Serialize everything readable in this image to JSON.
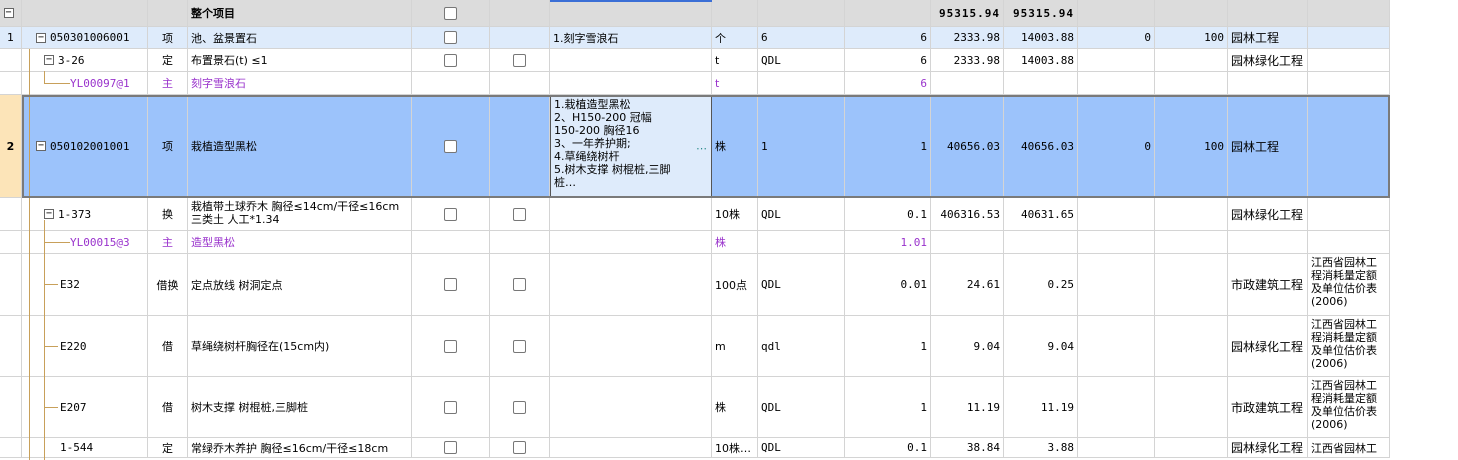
{
  "colors": {
    "summary_bg": "#dcdcdc",
    "row_hl": "#deebfb",
    "row_sel": "#9cc3fb",
    "sel_rowhdr": "#fce4b8",
    "purple": "#9932cc"
  },
  "summary": {
    "toggle": "−",
    "name": "整个项目",
    "total1": "95315.94",
    "total2": "95315.94"
  },
  "rows": [
    {
      "rn": "1",
      "code": "050301006001",
      "type": "项",
      "name": "池、盆景置石",
      "feature": "1.刻字雪浪石",
      "unit": "个",
      "expr": "6",
      "qty": "6",
      "price": "2333.98",
      "total": "14003.88",
      "c11": "0",
      "c12": "100",
      "cat": "园林工程",
      "src": ""
    },
    {
      "rn": "",
      "code": "3-26",
      "type": "定",
      "name": "布置景石(t) ≤1",
      "feature": "",
      "unit": "t",
      "expr": "QDL",
      "qty": "6",
      "price": "2333.98",
      "total": "14003.88",
      "c11": "",
      "c12": "",
      "cat": "园林绿化工程",
      "src": ""
    },
    {
      "rn": "",
      "code": "YL00097@1",
      "type": "主",
      "name": "刻字雪浪石",
      "feature": "",
      "unit": "t",
      "expr": "",
      "qty": "6",
      "price": "",
      "total": "",
      "c11": "",
      "c12": "",
      "cat": "",
      "src": ""
    },
    {
      "rn": "2",
      "code": "050102001001",
      "type": "项",
      "name": "栽植造型黑松",
      "feature": "1.栽植造型黑松\n2、H150-200 冠幅\n150-200  胸径16\n3、一年养护期;\n4.草绳绕树杆\n5.树木支撑 树棍桩,三脚\n桩…",
      "unit": "株",
      "expr": "1",
      "qty": "1",
      "price": "40656.03",
      "total": "40656.03",
      "c11": "0",
      "c12": "100",
      "cat": "园林工程",
      "src": ""
    },
    {
      "rn": "",
      "code": "1-373",
      "type": "换",
      "name": "栽植带土球乔木 胸径≤14cm/干径≤16cm\n  三类土 人工*1.34",
      "feature": "",
      "unit": "10株",
      "expr": "QDL",
      "qty": "0.1",
      "price": "406316.53",
      "total": "40631.65",
      "c11": "",
      "c12": "",
      "cat": "园林绿化工程",
      "src": ""
    },
    {
      "rn": "",
      "code": "YL00015@3",
      "type": "主",
      "name": "造型黑松",
      "feature": "",
      "unit": "株",
      "expr": "",
      "qty": "1.01",
      "price": "",
      "total": "",
      "c11": "",
      "c12": "",
      "cat": "",
      "src": ""
    },
    {
      "rn": "",
      "code": "E32",
      "type": "借换",
      "name": "定点放线 树洞定点",
      "feature": "",
      "unit": "100点",
      "expr": "QDL",
      "qty": "0.01",
      "price": "24.61",
      "total": "0.25",
      "c11": "",
      "c12": "",
      "cat": "市政建筑工程",
      "src": "江西省园林工\n程消耗量定额\n及单位估价表\n(2006)"
    },
    {
      "rn": "",
      "code": "E220",
      "type": "借",
      "name": "草绳绕树杆胸径在(15cm内)",
      "feature": "",
      "unit": "m",
      "expr": "qdl",
      "qty": "1",
      "price": "9.04",
      "total": "9.04",
      "c11": "",
      "c12": "",
      "cat": "园林绿化工程",
      "src": "江西省园林工\n程消耗量定额\n及单位估价表\n(2006)"
    },
    {
      "rn": "",
      "code": "E207",
      "type": "借",
      "name": "树木支撑 树棍桩,三脚桩",
      "feature": "",
      "unit": "株",
      "expr": "QDL",
      "qty": "1",
      "price": "11.19",
      "total": "11.19",
      "c11": "",
      "c12": "",
      "cat": "市政建筑工程",
      "src": "江西省园林工\n程消耗量定额\n及单位估价表\n(2006)"
    },
    {
      "rn": "",
      "code": "1-544",
      "type": "定",
      "name": "常绿乔木养护 胸径≤16cm/干径≤18cm",
      "feature": "",
      "unit": "10株…",
      "expr": "QDL",
      "qty": "0.1",
      "price": "38.84",
      "total": "3.88",
      "c11": "",
      "c12": "",
      "cat": "园林绿化工程",
      "src": "江西省园林工"
    }
  ]
}
